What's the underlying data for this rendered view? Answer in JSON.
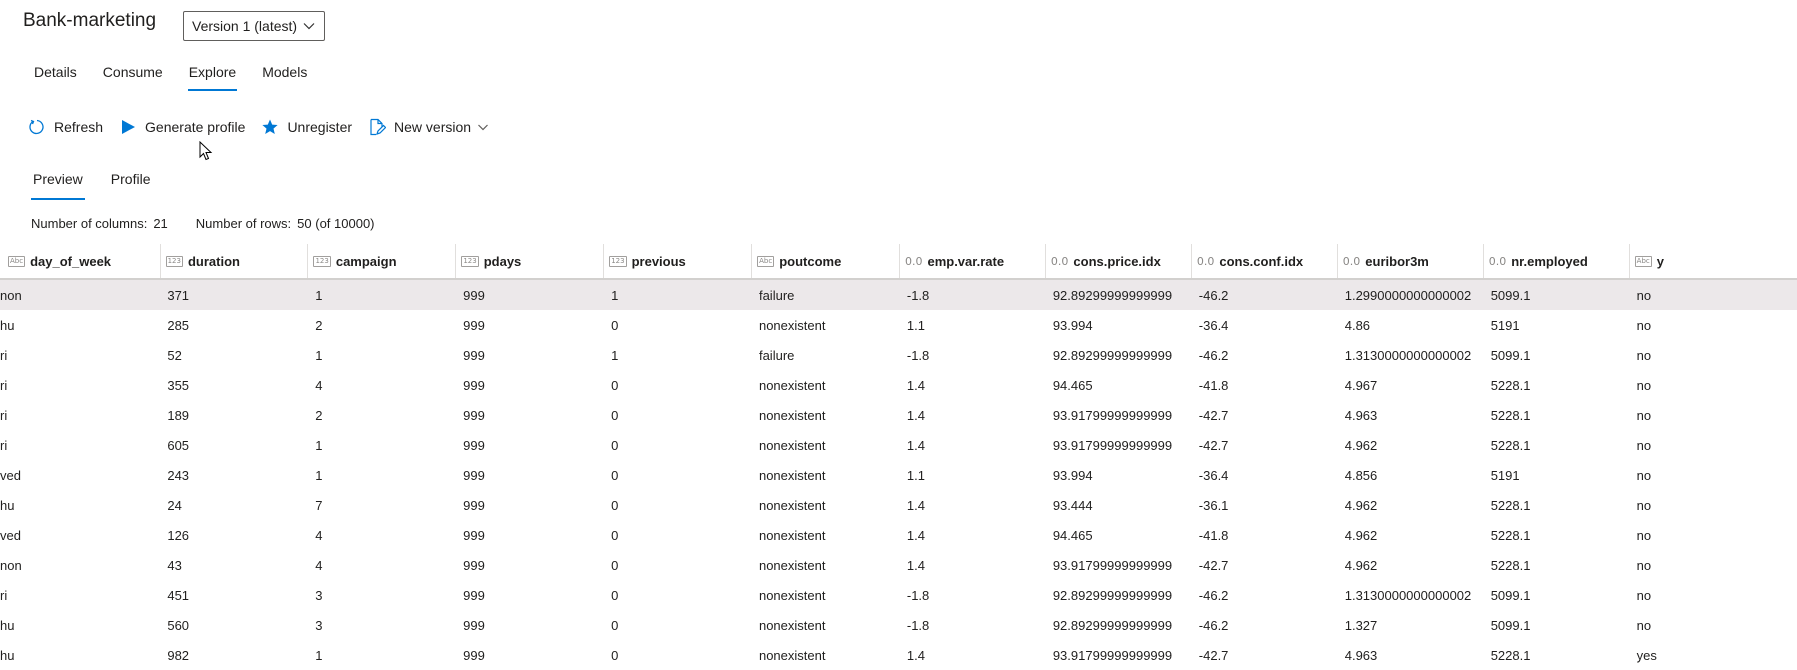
{
  "title": "Bank-marketing",
  "version_select": {
    "value": "Version 1 (latest)"
  },
  "tabs": [
    {
      "label": "Details"
    },
    {
      "label": "Consume"
    },
    {
      "label": "Explore",
      "active": true
    },
    {
      "label": "Models"
    }
  ],
  "toolbar": {
    "refresh": "Refresh",
    "generate_profile": "Generate profile",
    "unregister": "Unregister",
    "new_version": "New version"
  },
  "subtabs": [
    {
      "label": "Preview",
      "active": true
    },
    {
      "label": "Profile"
    }
  ],
  "stats": {
    "columns_label": "Number of columns:",
    "columns_value": "21",
    "rows_label": "Number of rows:",
    "rows_value": "50 (of 10000)"
  },
  "colors": {
    "accent": "#0078d4",
    "selected_row": "#ece8ea"
  },
  "table": {
    "columns": [
      {
        "name": "day_of_week",
        "type_icon": "Abc"
      },
      {
        "name": "duration",
        "type_icon": "123"
      },
      {
        "name": "campaign",
        "type_icon": "123"
      },
      {
        "name": "pdays",
        "type_icon": "123"
      },
      {
        "name": "previous",
        "type_icon": "123"
      },
      {
        "name": "poutcome",
        "type_icon": "Abc"
      },
      {
        "name": "emp.var.rate",
        "type_icon": "0.0"
      },
      {
        "name": "cons.price.idx",
        "type_icon": "0.0"
      },
      {
        "name": "cons.conf.idx",
        "type_icon": "0.0"
      },
      {
        "name": "euribor3m",
        "type_icon": "0.0"
      },
      {
        "name": "nr.employed",
        "type_icon": "0.0"
      },
      {
        "name": "y",
        "type_icon": "Abc"
      }
    ],
    "rows": [
      [
        "non",
        "371",
        "1",
        "999",
        "1",
        "failure",
        "-1.8",
        "92.89299999999999",
        "-46.2",
        "1.2990000000000002",
        "5099.1",
        "no"
      ],
      [
        "hu",
        "285",
        "2",
        "999",
        "0",
        "nonexistent",
        "1.1",
        "93.994",
        "-36.4",
        "4.86",
        "5191",
        "no"
      ],
      [
        "ri",
        "52",
        "1",
        "999",
        "1",
        "failure",
        "-1.8",
        "92.89299999999999",
        "-46.2",
        "1.3130000000000002",
        "5099.1",
        "no"
      ],
      [
        "ri",
        "355",
        "4",
        "999",
        "0",
        "nonexistent",
        "1.4",
        "94.465",
        "-41.8",
        "4.967",
        "5228.1",
        "no"
      ],
      [
        "ri",
        "189",
        "2",
        "999",
        "0",
        "nonexistent",
        "1.4",
        "93.91799999999999",
        "-42.7",
        "4.963",
        "5228.1",
        "no"
      ],
      [
        "ri",
        "605",
        "1",
        "999",
        "0",
        "nonexistent",
        "1.4",
        "93.91799999999999",
        "-42.7",
        "4.962",
        "5228.1",
        "no"
      ],
      [
        "ved",
        "243",
        "1",
        "999",
        "0",
        "nonexistent",
        "1.1",
        "93.994",
        "-36.4",
        "4.856",
        "5191",
        "no"
      ],
      [
        "hu",
        "24",
        "7",
        "999",
        "0",
        "nonexistent",
        "1.4",
        "93.444",
        "-36.1",
        "4.962",
        "5228.1",
        "no"
      ],
      [
        "ved",
        "126",
        "4",
        "999",
        "0",
        "nonexistent",
        "1.4",
        "94.465",
        "-41.8",
        "4.962",
        "5228.1",
        "no"
      ],
      [
        "non",
        "43",
        "4",
        "999",
        "0",
        "nonexistent",
        "1.4",
        "93.91799999999999",
        "-42.7",
        "4.962",
        "5228.1",
        "no"
      ],
      [
        "ri",
        "451",
        "3",
        "999",
        "0",
        "nonexistent",
        "-1.8",
        "92.89299999999999",
        "-46.2",
        "1.3130000000000002",
        "5099.1",
        "no"
      ],
      [
        "hu",
        "560",
        "3",
        "999",
        "0",
        "nonexistent",
        "-1.8",
        "92.89299999999999",
        "-46.2",
        "1.327",
        "5099.1",
        "no"
      ],
      [
        "hu",
        "982",
        "1",
        "999",
        "0",
        "nonexistent",
        "1.4",
        "93.91799999999999",
        "-42.7",
        "4.963",
        "5228.1",
        "yes"
      ]
    ]
  }
}
